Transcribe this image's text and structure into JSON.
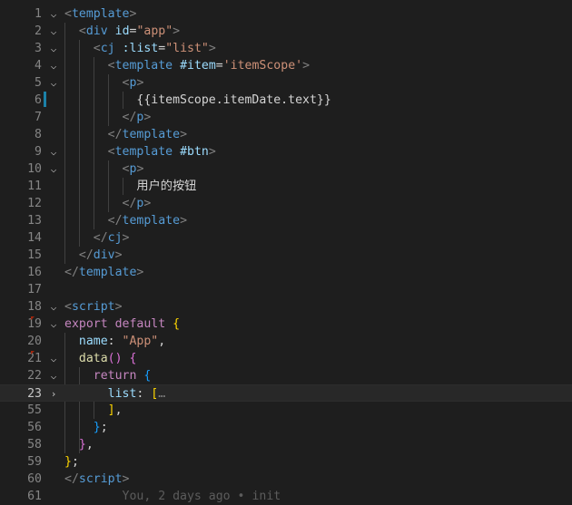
{
  "editor": {
    "lines": [
      {
        "num": "1",
        "fold": "⌵",
        "segments": [
          {
            "c": "tag",
            "t": "<"
          },
          {
            "c": "tname",
            "t": "template"
          },
          {
            "c": "tag",
            "t": ">"
          }
        ]
      },
      {
        "num": "2",
        "fold": "⌵",
        "segments": [
          {
            "c": "txt",
            "t": "  "
          },
          {
            "c": "tag",
            "t": "<"
          },
          {
            "c": "tname",
            "t": "div"
          },
          {
            "c": "txt",
            "t": " "
          },
          {
            "c": "attr",
            "t": "id"
          },
          {
            "c": "txt",
            "t": "="
          },
          {
            "c": "str",
            "t": "\"app\""
          },
          {
            "c": "tag",
            "t": ">"
          }
        ]
      },
      {
        "num": "3",
        "fold": "⌵",
        "segments": [
          {
            "c": "txt",
            "t": "    "
          },
          {
            "c": "tag",
            "t": "<"
          },
          {
            "c": "tname",
            "t": "cj"
          },
          {
            "c": "txt",
            "t": " "
          },
          {
            "c": "attr",
            "t": ":list"
          },
          {
            "c": "txt",
            "t": "="
          },
          {
            "c": "str",
            "t": "\"list\""
          },
          {
            "c": "tag",
            "t": ">"
          }
        ]
      },
      {
        "num": "4",
        "fold": "⌵",
        "segments": [
          {
            "c": "txt",
            "t": "      "
          },
          {
            "c": "tag",
            "t": "<"
          },
          {
            "c": "tname",
            "t": "template"
          },
          {
            "c": "txt",
            "t": " "
          },
          {
            "c": "attr",
            "t": "#item"
          },
          {
            "c": "txt",
            "t": "="
          },
          {
            "c": "str",
            "t": "'itemScope'"
          },
          {
            "c": "tag",
            "t": ">"
          }
        ]
      },
      {
        "num": "5",
        "fold": "⌵",
        "segments": [
          {
            "c": "txt",
            "t": "        "
          },
          {
            "c": "tag",
            "t": "<"
          },
          {
            "c": "tname",
            "t": "p"
          },
          {
            "c": "tag",
            "t": ">"
          }
        ]
      },
      {
        "num": "6",
        "fold": "",
        "segments": [
          {
            "c": "txt",
            "t": "          {{itemScope.itemDate.text}}"
          }
        ]
      },
      {
        "num": "7",
        "fold": "",
        "segments": [
          {
            "c": "txt",
            "t": "        "
          },
          {
            "c": "tag",
            "t": "</"
          },
          {
            "c": "tname",
            "t": "p"
          },
          {
            "c": "tag",
            "t": ">"
          }
        ]
      },
      {
        "num": "8",
        "fold": "",
        "segments": [
          {
            "c": "txt",
            "t": "      "
          },
          {
            "c": "tag",
            "t": "</"
          },
          {
            "c": "tname",
            "t": "template"
          },
          {
            "c": "tag",
            "t": ">"
          }
        ]
      },
      {
        "num": "9",
        "fold": "⌵",
        "segments": [
          {
            "c": "txt",
            "t": "      "
          },
          {
            "c": "tag",
            "t": "<"
          },
          {
            "c": "tname",
            "t": "template"
          },
          {
            "c": "txt",
            "t": " "
          },
          {
            "c": "attr",
            "t": "#btn"
          },
          {
            "c": "tag",
            "t": ">"
          }
        ]
      },
      {
        "num": "10",
        "fold": "⌵",
        "segments": [
          {
            "c": "txt",
            "t": "        "
          },
          {
            "c": "tag",
            "t": "<"
          },
          {
            "c": "tname",
            "t": "p"
          },
          {
            "c": "tag",
            "t": ">"
          }
        ]
      },
      {
        "num": "11",
        "fold": "",
        "segments": [
          {
            "c": "txt",
            "t": "          用户的按钮"
          }
        ]
      },
      {
        "num": "12",
        "fold": "",
        "segments": [
          {
            "c": "txt",
            "t": "        "
          },
          {
            "c": "tag",
            "t": "</"
          },
          {
            "c": "tname",
            "t": "p"
          },
          {
            "c": "tag",
            "t": ">"
          }
        ]
      },
      {
        "num": "13",
        "fold": "",
        "segments": [
          {
            "c": "txt",
            "t": "      "
          },
          {
            "c": "tag",
            "t": "</"
          },
          {
            "c": "tname",
            "t": "template"
          },
          {
            "c": "tag",
            "t": ">"
          }
        ]
      },
      {
        "num": "14",
        "fold": "",
        "segments": [
          {
            "c": "txt",
            "t": "    "
          },
          {
            "c": "tag",
            "t": "</"
          },
          {
            "c": "tname",
            "t": "cj"
          },
          {
            "c": "tag",
            "t": ">"
          }
        ]
      },
      {
        "num": "15",
        "fold": "",
        "segments": [
          {
            "c": "txt",
            "t": "  "
          },
          {
            "c": "tag",
            "t": "</"
          },
          {
            "c": "tname",
            "t": "div"
          },
          {
            "c": "tag",
            "t": ">"
          }
        ]
      },
      {
        "num": "16",
        "fold": "",
        "segments": [
          {
            "c": "tag",
            "t": "</"
          },
          {
            "c": "tname",
            "t": "template"
          },
          {
            "c": "tag",
            "t": ">"
          }
        ]
      },
      {
        "num": "17",
        "fold": "",
        "segments": []
      },
      {
        "num": "18",
        "fold": "⌵",
        "segments": [
          {
            "c": "tag",
            "t": "<"
          },
          {
            "c": "tname",
            "t": "script"
          },
          {
            "c": "tag",
            "t": ">"
          }
        ]
      },
      {
        "num": "19",
        "fold": "⌵",
        "breakpoint": true,
        "segments": [
          {
            "c": "kw",
            "t": "export"
          },
          {
            "c": "txt",
            "t": " "
          },
          {
            "c": "kw",
            "t": "default"
          },
          {
            "c": "txt",
            "t": " "
          },
          {
            "c": "b1",
            "t": "{"
          }
        ]
      },
      {
        "num": "20",
        "fold": "",
        "segments": [
          {
            "c": "txt",
            "t": "  "
          },
          {
            "c": "prop",
            "t": "name"
          },
          {
            "c": "txt",
            "t": ": "
          },
          {
            "c": "str",
            "t": "\"App\""
          },
          {
            "c": "txt",
            "t": ","
          }
        ]
      },
      {
        "num": "21",
        "fold": "⌵",
        "breakpoint": true,
        "segments": [
          {
            "c": "txt",
            "t": "  "
          },
          {
            "c": "fn",
            "t": "data"
          },
          {
            "c": "b2",
            "t": "()"
          },
          {
            "c": "txt",
            "t": " "
          },
          {
            "c": "b2",
            "t": "{"
          }
        ]
      },
      {
        "num": "22",
        "fold": "⌵",
        "segments": [
          {
            "c": "txt",
            "t": "    "
          },
          {
            "c": "kw",
            "t": "return"
          },
          {
            "c": "txt",
            "t": " "
          },
          {
            "c": "b3",
            "t": "{"
          }
        ]
      },
      {
        "num": "23",
        "fold": "›",
        "current": true,
        "segments": [
          {
            "c": "txt",
            "t": "      "
          },
          {
            "c": "prop",
            "t": "list"
          },
          {
            "c": "txt",
            "t": ": "
          },
          {
            "c": "b1",
            "t": "["
          },
          {
            "c": "dots",
            "t": "…"
          }
        ]
      },
      {
        "num": "55",
        "fold": "",
        "segments": [
          {
            "c": "txt",
            "t": "      "
          },
          {
            "c": "b1",
            "t": "]"
          },
          {
            "c": "txt",
            "t": ","
          }
        ]
      },
      {
        "num": "56",
        "fold": "",
        "segments": [
          {
            "c": "txt",
            "t": "    "
          },
          {
            "c": "b3",
            "t": "}"
          },
          {
            "c": "txt",
            "t": ";"
          }
        ]
      },
      {
        "num": "58",
        "fold": "",
        "segments": [
          {
            "c": "txt",
            "t": "  "
          },
          {
            "c": "b2",
            "t": "}"
          },
          {
            "c": "txt",
            "t": ","
          }
        ]
      },
      {
        "num": "59",
        "fold": "",
        "segments": [
          {
            "c": "b1",
            "t": "}"
          },
          {
            "c": "txt",
            "t": ";"
          }
        ]
      },
      {
        "num": "60",
        "fold": "",
        "segments": [
          {
            "c": "tag",
            "t": "</"
          },
          {
            "c": "tname",
            "t": "script"
          },
          {
            "c": "tag",
            "t": ">"
          }
        ]
      },
      {
        "num": "61",
        "fold": "",
        "segments": [
          {
            "c": "txt",
            "t": "  "
          },
          {
            "c": "blame",
            "t": "      You, 2 days ago • init"
          }
        ]
      }
    ]
  }
}
